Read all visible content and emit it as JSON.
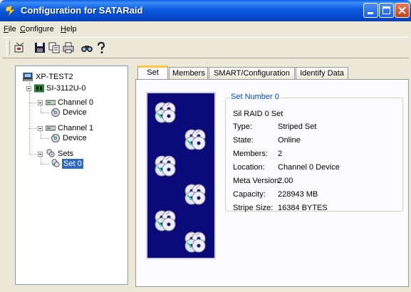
{
  "window": {
    "title": "Configuration for SATARaid"
  },
  "menu": [
    {
      "label": "File",
      "accel": "F"
    },
    {
      "label": "Configure",
      "accel": "C"
    },
    {
      "label": "Help",
      "accel": "H"
    }
  ],
  "toolbar": {
    "buttons": [
      "raid-tool-icon",
      "save-icon",
      "copy-icon",
      "print-icon",
      "find-icon",
      "help-icon"
    ]
  },
  "tree": {
    "root": "XP-TEST2",
    "controller": "SI-3112U-0",
    "channel0": "Channel 0",
    "channel0_device": "Device",
    "channel1": "Channel 1",
    "channel1_device": "Device",
    "sets": "Sets",
    "set0": "Set 0"
  },
  "tabs": [
    "Set",
    "Members",
    "SMART/Configuration",
    "Identify Data"
  ],
  "set": {
    "group_title": "Set Number 0",
    "name": "Sil RAID 0 Set",
    "props": [
      {
        "label": "Type:",
        "value": "Striped Set"
      },
      {
        "label": "State:",
        "value": "Online"
      },
      {
        "label": "Members:",
        "value": "2"
      },
      {
        "label": "Location:",
        "value": "Channel 0 Device"
      },
      {
        "label": "Meta Version:",
        "value": "2.00"
      },
      {
        "label": "Capacity:",
        "value": "228943 MB"
      },
      {
        "label": "Stripe Size:",
        "value": "16384 BYTES"
      }
    ]
  },
  "colors": {
    "titlebar": "#0a5fe8",
    "panel_bg": "#ece9d8",
    "image_bg": "#0a0a7a",
    "selection": "#316ac5",
    "group_title": "#0046d5"
  }
}
